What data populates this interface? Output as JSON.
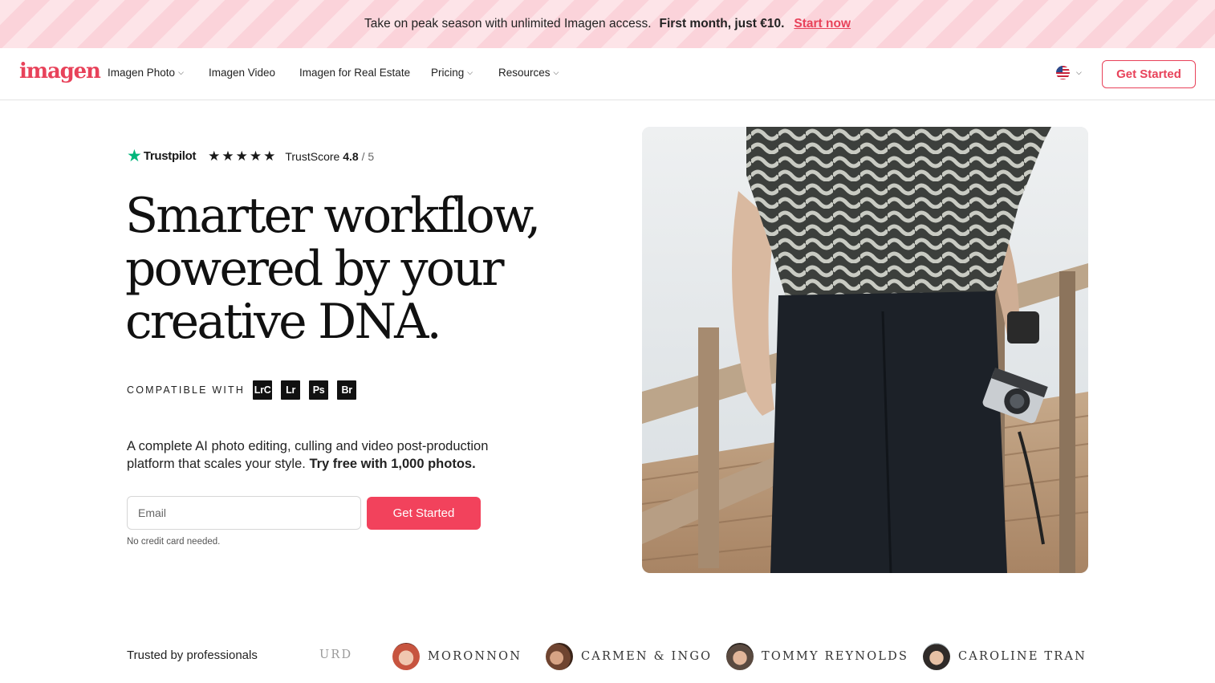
{
  "promo": {
    "text": "Take on peak season with unlimited Imagen access.",
    "highlight": "First month, just €10.",
    "link": "Start now"
  },
  "nav": {
    "logo": "imagen",
    "items": [
      {
        "label": "Imagen Photo",
        "dropdown": true
      },
      {
        "label": "Imagen Video",
        "dropdown": false
      },
      {
        "label": "Imagen for Real Estate",
        "dropdown": false
      },
      {
        "label": "Pricing",
        "dropdown": true
      },
      {
        "label": "Resources",
        "dropdown": true
      }
    ],
    "language_icon": "us-flag-icon",
    "cta": "Get Started"
  },
  "hero": {
    "trustpilot": {
      "brand": "Trustpilot",
      "stars": "★★★★★",
      "score_label": "TrustScore",
      "score": "4.8",
      "out_of": "/ 5"
    },
    "headline": [
      "Smarter workflow,",
      "powered by your",
      "creative DNA."
    ],
    "compatible_label": "COMPATIBLE WITH",
    "apps": [
      "LrC",
      "Lr",
      "Ps",
      "Br"
    ],
    "description": "A complete AI photo editing, culling and video post-production platform that scales your style.",
    "description_bold": "Try free with 1,000 photos.",
    "email_placeholder": "Email",
    "cta": "Get Started",
    "note": "No credit card needed."
  },
  "trusted": {
    "label": "Trusted by professionals",
    "fragment": "URD",
    "logos": [
      "MORONNON",
      "CARMEN & INGO",
      "TOMMY REYNOLDS",
      "CAROLINE TRAN"
    ]
  },
  "colors": {
    "brand": "#e8425a",
    "cta": "#f2425c",
    "trustpilot": "#00b67a"
  }
}
